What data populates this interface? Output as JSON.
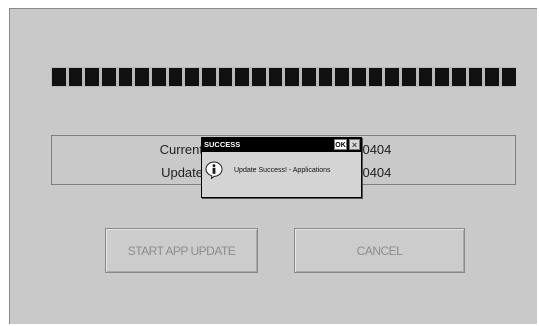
{
  "version_panel": {
    "current_label": "Current",
    "current_value": "080404",
    "update_label": "Update",
    "update_value": "080404"
  },
  "progress": {
    "segments": 28,
    "fill_fraction": 1.0
  },
  "buttons": {
    "start_label": "START APP UPDATE",
    "cancel_label": "CANCEL"
  },
  "message_box": {
    "title": "SUCCESS",
    "ok_label": "OK",
    "close_glyph": "×",
    "message": "Update Success! - Applications",
    "icon": "info-icon"
  },
  "colors": {
    "background": "#c9c9c9",
    "progress_fill": "#111111",
    "titlebar": "#000000"
  }
}
